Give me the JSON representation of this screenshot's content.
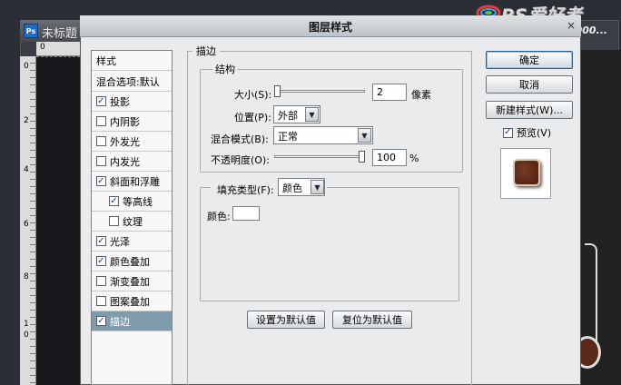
{
  "background": {
    "doc_title": "未标题",
    "ps_badge": "Ps",
    "ruler_numbers": [
      "0",
      "2",
      "4",
      "6",
      "8",
      "1",
      "0"
    ]
  },
  "watermark": {
    "brand": "PS爱好者",
    "url": "www.PS2000..."
  },
  "dialog": {
    "title": "图层样式",
    "close_glyph": "×"
  },
  "style_list": {
    "header": "样式",
    "blend_options": "混合选项:默认",
    "items": [
      {
        "label": "投影",
        "checked": true,
        "indent": false,
        "selected": false
      },
      {
        "label": "内阴影",
        "checked": false,
        "indent": false,
        "selected": false
      },
      {
        "label": "外发光",
        "checked": false,
        "indent": false,
        "selected": false
      },
      {
        "label": "内发光",
        "checked": false,
        "indent": false,
        "selected": false
      },
      {
        "label": "斜面和浮雕",
        "checked": true,
        "indent": false,
        "selected": false
      },
      {
        "label": "等高线",
        "checked": true,
        "indent": true,
        "selected": false
      },
      {
        "label": "纹理",
        "checked": false,
        "indent": true,
        "selected": false
      },
      {
        "label": "光泽",
        "checked": true,
        "indent": false,
        "selected": false
      },
      {
        "label": "颜色叠加",
        "checked": true,
        "indent": false,
        "selected": false
      },
      {
        "label": "渐变叠加",
        "checked": false,
        "indent": false,
        "selected": false
      },
      {
        "label": "图案叠加",
        "checked": false,
        "indent": false,
        "selected": false
      },
      {
        "label": "描边",
        "checked": true,
        "indent": false,
        "selected": true
      }
    ]
  },
  "stroke": {
    "group_label": "描边",
    "structure_label": "结构",
    "size_label": "大小(S):",
    "size_value": "2",
    "size_unit": "像素",
    "size_fraction": 0.0,
    "position_label": "位置(P):",
    "position_value": "外部",
    "blend_mode_label": "混合模式(B):",
    "blend_mode_value": "正常",
    "opacity_label": "不透明度(O):",
    "opacity_value": "100",
    "opacity_unit": "%",
    "opacity_fraction": 1.0,
    "fill_type_label": "填充类型(F):",
    "fill_type_value": "颜色",
    "color_label": "颜色:",
    "color_value": "#ffffff"
  },
  "bottom_buttons": {
    "set_default": "设置为默认值",
    "reset_default": "复位为默认值"
  },
  "right_panel": {
    "ok": "确定",
    "cancel": "取消",
    "new_style": "新建样式(W)...",
    "preview_label": "预览(V)",
    "preview_checked": true
  }
}
